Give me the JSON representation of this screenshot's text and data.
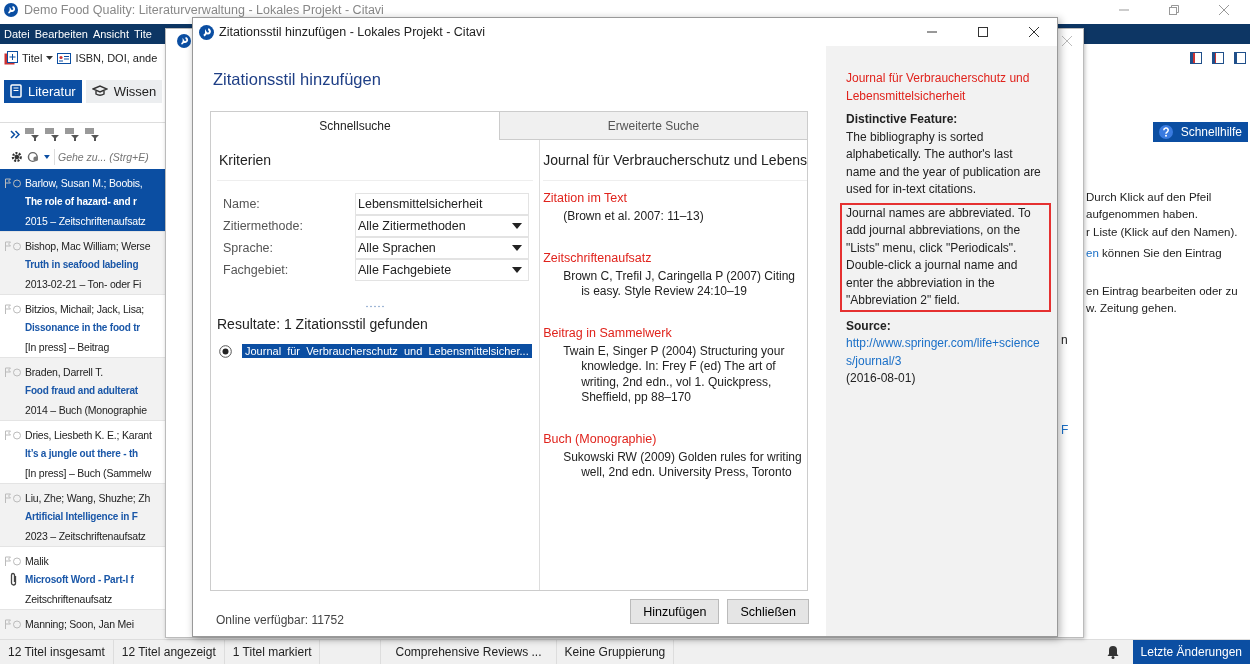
{
  "app": {
    "title": "Demo Food Quality: Literaturverwaltung - Lokales Projekt - Citavi",
    "menu": [
      "Datei",
      "Bearbeiten",
      "Ansicht",
      "Tite"
    ],
    "toolbar": {
      "new_title": "Titel",
      "isbn": "ISBN, DOI, ande"
    },
    "nav": [
      {
        "label": "Literatur",
        "selected": true
      },
      {
        "label": "Wissen",
        "selected": false
      }
    ],
    "goto_placeholder": "Gehe zu... (Strg+E)",
    "references": [
      {
        "author": "Barlow, Susan M.; Boobis,",
        "title": "The role of hazard- and r",
        "meta": "2015 – Zeitschriftenaufsatz",
        "selected": true,
        "attachment": false
      },
      {
        "author": "Bishop, Mac William; Werse",
        "title": "Truth in seafood labeling",
        "meta": "2013-02-21 – Ton- oder Fi",
        "selected": false,
        "attachment": false
      },
      {
        "author": "Bitzios, Michail; Jack, Lisa;",
        "title": "Dissonance in the food tr",
        "meta": "[In press] – Beitrag",
        "selected": false,
        "attachment": false
      },
      {
        "author": "Braden, Darrell T.",
        "title": "Food fraud and adulterat",
        "meta": "2014 – Buch (Monographie",
        "selected": false,
        "attachment": false
      },
      {
        "author": "Dries, Liesbeth K. E.; Karant",
        "title": "It’s a jungle out there - th",
        "meta": "[In press] – Buch (Sammelw",
        "selected": false,
        "attachment": false
      },
      {
        "author": "Liu, Zhe; Wang, Shuzhe; Zh",
        "title": "Artificial Intelligence in F",
        "meta": "2023 – Zeitschriftenaufsatz",
        "selected": false,
        "attachment": false
      },
      {
        "author": "Malik",
        "title": "Microsoft Word - Part-I f",
        "meta": "Zeitschriftenaufsatz",
        "selected": false,
        "attachment": true
      },
      {
        "author": "Manning; Soon, Jan Mei",
        "selected": false
      }
    ],
    "help_button": "Schnellhilfe",
    "help_lines": [
      {
        "text": "Durch Klick auf den Pfeil"
      },
      {
        "text": "aufgenommen haben."
      },
      {
        "text": "r Liste (Klick auf den Namen)."
      },
      {
        "link": "en",
        "text": " können Sie den Eintrag"
      },
      {
        "text": "en Eintrag bearbeiten oder zu"
      },
      {
        "text": "w. Zeitung gehen."
      }
    ]
  },
  "rear_window": {
    "fragments": [
      {
        "text": "n",
        "link": false
      },
      {
        "text": "F",
        "link": true
      }
    ]
  },
  "dialog": {
    "title": "Zitationsstil hinzufügen - Lokales Projekt - Citavi",
    "heading": "Zitationsstil hinzufügen",
    "tabs": [
      {
        "label": "Schnellsuche",
        "selected": true
      },
      {
        "label": "Erweiterte Suche",
        "selected": false
      }
    ],
    "criteria_title": "Kriterien",
    "criteria": [
      {
        "label": "Name:",
        "value": "Lebensmittelsicherheit",
        "kind": "text"
      },
      {
        "label": "Zitiermethode:",
        "value": "Alle Zitiermethoden",
        "kind": "dropdown"
      },
      {
        "label": "Sprache:",
        "value": "Alle Sprachen",
        "kind": "dropdown"
      },
      {
        "label": "Fachgebiet:",
        "value": "Alle Fachgebiete",
        "kind": "dropdown"
      }
    ],
    "results_title": "Resultate: 1 Zitationsstil gefunden",
    "results": [
      {
        "label": "Journal  für  Verbraucherschutz  und  Lebensmittelsicher...",
        "selected": true
      }
    ],
    "preview": {
      "title": "Journal für Verbraucherschutz und Lebens",
      "sections": [
        {
          "heading": "Zitation im Text",
          "text": "(Brown et al. 2007: 11–13)"
        },
        {
          "heading": "Zeitschriftenaufsatz",
          "text": "Brown C, Trefil J, Caringella P (2007) Citing is easy. Style Review 24:10–19"
        },
        {
          "heading": "Beitrag in Sammelwerk",
          "text": "Twain E, Singer P (2004) Structuring your knowledge. In: Frey F (ed) The art of writing, 2nd edn., vol 1. Quickpress, Sheffield, pp 88–170"
        },
        {
          "heading": "Buch (Monographie)",
          "text": "Sukowski RW (2009) Golden rules for writing well, 2nd edn. University Press, Toronto"
        }
      ]
    },
    "online": "Online verfügbar: 11752",
    "buttons": [
      "Hinzufügen",
      "Schließen"
    ],
    "info": {
      "title": "Journal für Verbraucherschutz und Lebensmittelsicherheit",
      "feature_label": "Distinctive Feature:",
      "feature_text": "The bibliography is sorted alphabetically. The author's last name and the year of publication are used for in-text citations.",
      "note": "Journal names are abbreviated. To add journal abbreviations, on the \"Lists\" menu, click \"Periodicals\". Double-click a journal name and enter the abbreviation in the \"Abbreviation 2\" field.",
      "source_label": "Source:",
      "source_url": "http://www.springer.com/life+sciences/journal/3",
      "source_date": "(2016-08-01)"
    }
  },
  "status_bar": {
    "items": [
      "12 Titel insgesamt",
      "12 Titel angezeigt",
      "1 Titel markiert",
      "Comprehensive Reviews ...",
      "Keine Gruppierung"
    ],
    "recent_button": "Letzte Änderungen"
  }
}
